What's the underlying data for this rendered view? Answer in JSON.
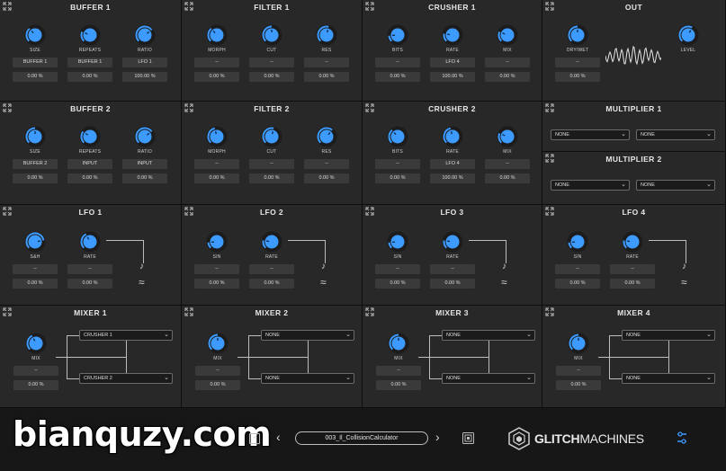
{
  "colors": {
    "accent": "#3d9bff",
    "panel": "#282828",
    "value_box": "#3a3a3a",
    "background": "#0d0d0d"
  },
  "panels": {
    "buffer1": {
      "title": "BUFFER 1",
      "knobs": [
        {
          "label": "SIZE",
          "source": "BUFFER 1",
          "amount": "0.00 %",
          "level": 0.35
        },
        {
          "label": "REPEATS",
          "source": "BUFFER 1",
          "amount": "0.00 %",
          "level": 0.25
        },
        {
          "label": "RATIO",
          "source": "LFO 1",
          "amount": "100.00 %",
          "level": 0.7
        }
      ]
    },
    "filter1": {
      "title": "FILTER 1",
      "knobs": [
        {
          "label": "MORPH",
          "source": "--",
          "amount": "0.00 %",
          "level": 0.35
        },
        {
          "label": "CUT",
          "source": "--",
          "amount": "0.00 %",
          "level": 0.5
        },
        {
          "label": "RES",
          "source": "--",
          "amount": "0.00 %",
          "level": 0.55
        }
      ]
    },
    "crusher1": {
      "title": "CRUSHER 1",
      "knobs": [
        {
          "label": "BITS",
          "source": "--",
          "amount": "0.00 %",
          "level": 0.15
        },
        {
          "label": "RATE",
          "source": "LFO 4",
          "amount": "100.00 %",
          "level": 0.2
        },
        {
          "label": "MIX",
          "source": "--",
          "amount": "0.00 %",
          "level": 0.25
        }
      ]
    },
    "out": {
      "title": "OUT",
      "knobs": [
        {
          "label": "DRY/WET",
          "source": "--",
          "amount": "0.00 %",
          "level": 0.5
        },
        {
          "label": "LEVEL",
          "source": "",
          "amount": "",
          "level": 0.6
        }
      ]
    },
    "buffer2": {
      "title": "BUFFER 2",
      "knobs": [
        {
          "label": "SIZE",
          "source": "BUFFER 2",
          "amount": "0.00 %",
          "level": 0.5
        },
        {
          "label": "REPEATS",
          "source": "INPUT",
          "amount": "0.00 %",
          "level": 0.3
        },
        {
          "label": "RATIO",
          "source": "INPUT",
          "amount": "0.00 %",
          "level": 0.7
        }
      ]
    },
    "filter2": {
      "title": "FILTER 2",
      "knobs": [
        {
          "label": "MORPH",
          "source": "--",
          "amount": "0.00 %",
          "level": 0.45
        },
        {
          "label": "CUT",
          "source": "--",
          "amount": "0.00 %",
          "level": 0.55
        },
        {
          "label": "RES",
          "source": "--",
          "amount": "0.00 %",
          "level": 0.65
        }
      ]
    },
    "crusher2": {
      "title": "CRUSHER 2",
      "knobs": [
        {
          "label": "BITS",
          "source": "--",
          "amount": "0.00 %",
          "level": 0.35
        },
        {
          "label": "RATE",
          "source": "LFO 4",
          "amount": "100.00 %",
          "level": 0.45
        },
        {
          "label": "MIX",
          "source": "--",
          "amount": "0.00 %",
          "level": 0.25
        }
      ]
    },
    "multiplier1": {
      "title": "MULTIPLIER 1",
      "select_a": "NONE",
      "select_b": "NONE"
    },
    "multiplier2": {
      "title": "MULTIPLIER 2",
      "select_a": "NONE",
      "select_b": "NONE"
    },
    "lfo1": {
      "title": "LFO 1",
      "knobs": [
        {
          "label": "S&H",
          "source": "--",
          "amount": "0.00 %",
          "level": 0.8
        },
        {
          "label": "RATE",
          "source": "--",
          "amount": "0.00 %",
          "level": 0.4
        }
      ],
      "sync": "♪",
      "wave": "≈"
    },
    "lfo2": {
      "title": "LFO 2",
      "knobs": [
        {
          "label": "SIN",
          "source": "--",
          "amount": "0.00 %",
          "level": 0.15
        },
        {
          "label": "RATE",
          "source": "--",
          "amount": "0.00 %",
          "level": 0.2
        }
      ],
      "sync": "♪",
      "wave": "≈"
    },
    "lfo3": {
      "title": "LFO 3",
      "knobs": [
        {
          "label": "SIN",
          "source": "--",
          "amount": "0.00 %",
          "level": 0.15
        },
        {
          "label": "RATE",
          "source": "--",
          "amount": "0.00 %",
          "level": 0.2
        }
      ],
      "sync": "♪",
      "wave": "≈"
    },
    "lfo4": {
      "title": "LFO 4",
      "knobs": [
        {
          "label": "SIN",
          "source": "--",
          "amount": "0.00 %",
          "level": 0.15
        },
        {
          "label": "RATE",
          "source": "--",
          "amount": "0.00 %",
          "level": 0.2
        }
      ],
      "sync": "♪",
      "wave": "≈"
    },
    "mixer1": {
      "title": "MIXER 1",
      "knob": {
        "label": "MIX",
        "source": "--",
        "amount": "0.00 %",
        "level": 0.4
      },
      "select_a": "CRUSHER 1",
      "select_b": "CRUSHER 2"
    },
    "mixer2": {
      "title": "MIXER 2",
      "knob": {
        "label": "MIX",
        "source": "--",
        "amount": "0.00 %",
        "level": 0.5
      },
      "select_a": "NONE",
      "select_b": "NONE"
    },
    "mixer3": {
      "title": "MIXER 3",
      "knob": {
        "label": "MIX",
        "source": "--",
        "amount": "0.00 %",
        "level": 0.5
      },
      "select_a": "NONE",
      "select_b": "NONE"
    },
    "mixer4": {
      "title": "MIXER 4",
      "knob": {
        "label": "MIX",
        "source": "--",
        "amount": "0.00 %",
        "level": 0.5
      },
      "select_a": "NONE",
      "select_b": "NONE"
    }
  },
  "footer": {
    "watermark": "bianquzy.com",
    "preset_name": "003_Il_CollisionCalculator",
    "prev": "‹",
    "next": "›",
    "logo_bold": "GLITCH",
    "logo_light": "MACHINES",
    "icons": [
      "preset-menu-icon",
      "save-preset-icon",
      "glitchmachines-logo-icon",
      "settings-icon"
    ]
  }
}
